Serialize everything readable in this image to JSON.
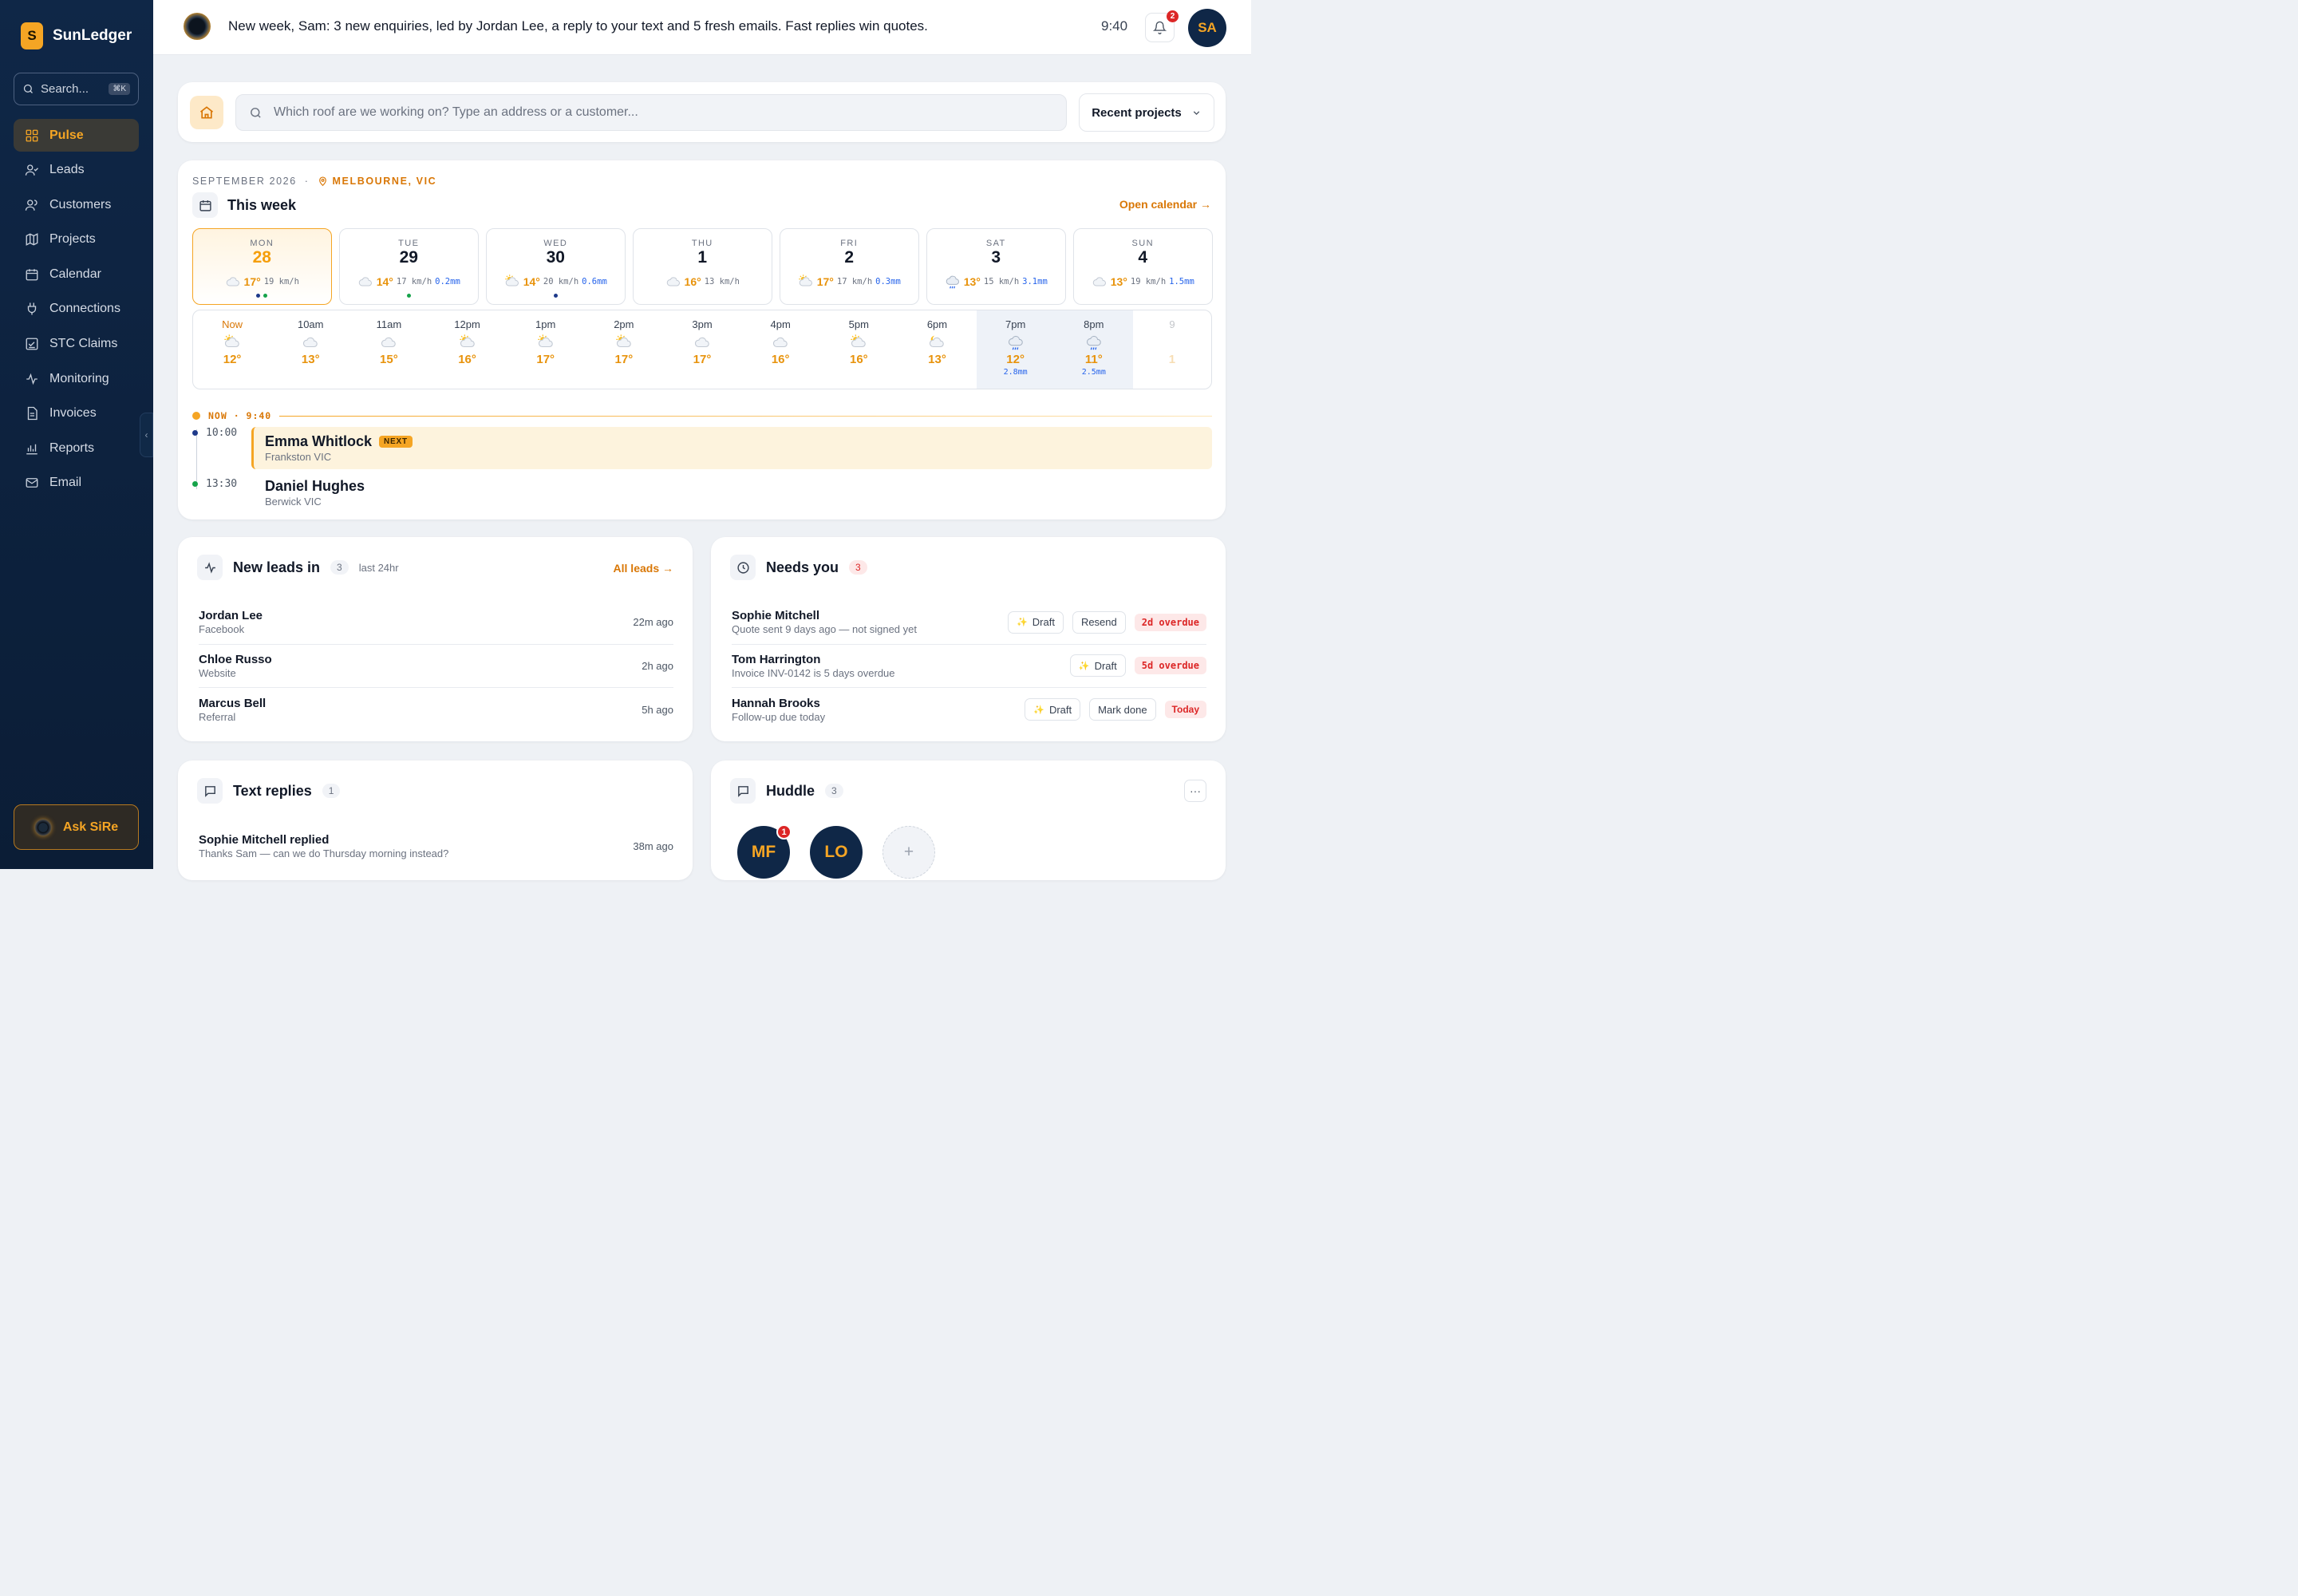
{
  "app": {
    "name": "SunLedger",
    "logo_letter": "S"
  },
  "sidebar": {
    "search_placeholder": "Search...",
    "search_shortcut": "⌘K",
    "items": [
      {
        "label": "Pulse",
        "icon": "grid-icon",
        "active": true
      },
      {
        "label": "Leads",
        "icon": "user-check-icon"
      },
      {
        "label": "Customers",
        "icon": "users-icon"
      },
      {
        "label": "Projects",
        "icon": "map-icon"
      },
      {
        "label": "Calendar",
        "icon": "calendar-icon"
      },
      {
        "label": "Connections",
        "icon": "plug-icon"
      },
      {
        "label": "STC Claims",
        "icon": "checklist-icon"
      },
      {
        "label": "Monitoring",
        "icon": "activity-icon"
      },
      {
        "label": "Invoices",
        "icon": "file-icon"
      },
      {
        "label": "Reports",
        "icon": "bar-chart-icon"
      },
      {
        "label": "Email",
        "icon": "mail-icon"
      }
    ],
    "ask_label": "Ask SiRe"
  },
  "topbar": {
    "message": "New week, Sam: 3 new enquiries, led by Jordan Lee, a reply to your text and 5 fresh emails. Fast replies win quotes.",
    "time": "9:40",
    "notifications": "2",
    "avatar": "SA"
  },
  "address_bar": {
    "placeholder": "Which roof are we working on? Type an address or a customer...",
    "recent_label": "Recent projects"
  },
  "week": {
    "month": "SEPTEMBER 2026",
    "location": "MELBOURNE, VIC",
    "title": "This week",
    "open_calendar": "Open calendar →",
    "days": [
      {
        "name": "MON",
        "date": "28",
        "icon": "cloud",
        "temp": "17°",
        "wind": "19 km/h",
        "rain": "",
        "dots": [
          "#1e3a8a",
          "#16a34a"
        ],
        "today": true
      },
      {
        "name": "TUE",
        "date": "29",
        "icon": "cloud",
        "temp": "14°",
        "wind": "17 km/h",
        "rain": "0.2mm",
        "dots": [
          "#16a34a"
        ]
      },
      {
        "name": "WED",
        "date": "30",
        "icon": "sun-cloud",
        "temp": "14°",
        "wind": "20 km/h",
        "rain": "0.6mm",
        "dots": [
          "#1e3a8a"
        ]
      },
      {
        "name": "THU",
        "date": "1",
        "icon": "cloud",
        "temp": "16°",
        "wind": "13 km/h",
        "rain": "",
        "dots": []
      },
      {
        "name": "FRI",
        "date": "2",
        "icon": "sun-cloud",
        "temp": "17°",
        "wind": "17 km/h",
        "rain": "0.3mm",
        "dots": []
      },
      {
        "name": "SAT",
        "date": "3",
        "icon": "rain",
        "temp": "13°",
        "wind": "15 km/h",
        "rain": "3.1mm",
        "dots": []
      },
      {
        "name": "SUN",
        "date": "4",
        "icon": "cloud",
        "temp": "13°",
        "wind": "19 km/h",
        "rain": "1.5mm",
        "dots": []
      }
    ],
    "hours": [
      {
        "label": "Now",
        "icon": "sun-cloud",
        "temp": "12°",
        "rain": "",
        "now": true
      },
      {
        "label": "10am",
        "icon": "cloud",
        "temp": "13°",
        "rain": ""
      },
      {
        "label": "11am",
        "icon": "cloud",
        "temp": "15°",
        "rain": ""
      },
      {
        "label": "12pm",
        "icon": "sun-cloud",
        "temp": "16°",
        "rain": ""
      },
      {
        "label": "1pm",
        "icon": "sun-cloud",
        "temp": "17°",
        "rain": ""
      },
      {
        "label": "2pm",
        "icon": "sun-cloud",
        "temp": "17°",
        "rain": ""
      },
      {
        "label": "3pm",
        "icon": "cloud",
        "temp": "17°",
        "rain": ""
      },
      {
        "label": "4pm",
        "icon": "cloud",
        "temp": "16°",
        "rain": ""
      },
      {
        "label": "5pm",
        "icon": "sun-cloud",
        "temp": "16°",
        "rain": ""
      },
      {
        "label": "6pm",
        "icon": "moon-cloud",
        "temp": "13°",
        "rain": ""
      },
      {
        "label": "7pm",
        "icon": "rain",
        "temp": "12°",
        "rain": "2.8mm",
        "highlight": true
      },
      {
        "label": "8pm",
        "icon": "rain",
        "temp": "11°",
        "rain": "2.5mm",
        "highlight": true
      },
      {
        "label": "9",
        "icon": "",
        "temp": "1",
        "rain": "",
        "fade": true
      }
    ],
    "now_label": "NOW · 9:40",
    "appointments": [
      {
        "time": "10:00",
        "name": "Emma Whitlock",
        "tag": "NEXT",
        "location": "Frankston VIC"
      },
      {
        "time": "13:30",
        "name": "Daniel Hughes",
        "tag": "",
        "location": "Berwick VIC"
      }
    ]
  },
  "new_leads": {
    "title": "New leads in",
    "count": "3",
    "period": "last 24hr",
    "link": "All leads →",
    "rows": [
      {
        "name": "Jordan Lee",
        "source": "Facebook",
        "ago": "22m ago"
      },
      {
        "name": "Chloe Russo",
        "source": "Website",
        "ago": "2h ago"
      },
      {
        "name": "Marcus Bell",
        "source": "Referral",
        "ago": "5h ago"
      }
    ]
  },
  "needs_you": {
    "title": "Needs you",
    "count": "3",
    "rows": [
      {
        "name": "Sophie Mitchell",
        "detail": "Quote sent 9 days ago — not signed yet",
        "draft": "Draft",
        "action": "Resend",
        "status": "2d overdue"
      },
      {
        "name": "Tom Harrington",
        "detail": "Invoice INV-0142 is 5 days overdue",
        "draft": "Draft",
        "action": "",
        "status": "5d overdue"
      },
      {
        "name": "Hannah Brooks",
        "detail": "Follow-up due today",
        "draft": "Draft",
        "action": "Mark done",
        "status": "Today"
      }
    ]
  },
  "text_replies": {
    "title": "Text replies",
    "count": "1",
    "rows": [
      {
        "name": "Sophie Mitchell replied",
        "message": "Thanks Sam — can we do Thursday morning instead?",
        "ago": "38m ago"
      }
    ]
  },
  "huddle": {
    "title": "Huddle",
    "count": "3",
    "members": [
      {
        "initials": "MF",
        "badge": "1"
      },
      {
        "initials": "LO",
        "badge": ""
      }
    ],
    "add_label": "+",
    "more_label": "···"
  }
}
